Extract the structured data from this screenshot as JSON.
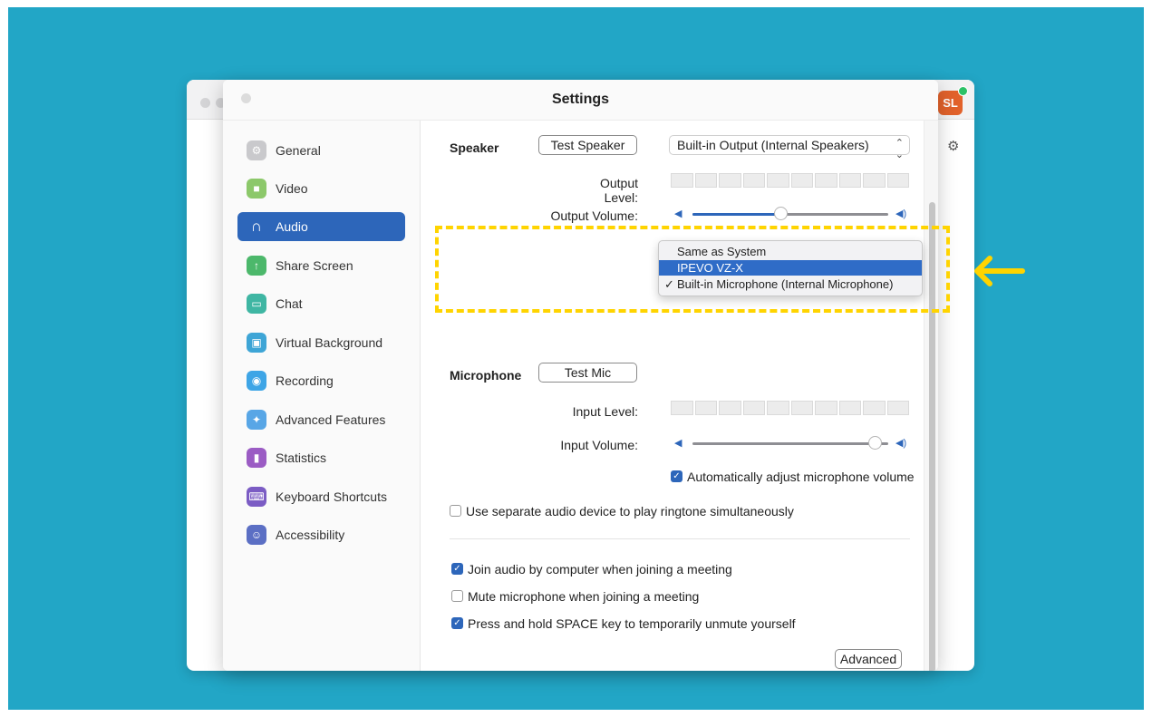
{
  "window": {
    "title": "Settings",
    "avatar_initials": "SL"
  },
  "sidebar": {
    "items": [
      {
        "label": "General",
        "icon": "gear-icon",
        "color": "#c9c9cc"
      },
      {
        "label": "Video",
        "icon": "video-icon",
        "color": "#8cc86a"
      },
      {
        "label": "Audio",
        "icon": "headphones-icon",
        "color": "#2d66ba",
        "active": true
      },
      {
        "label": "Share Screen",
        "icon": "share-screen-icon",
        "color": "#4cb86b"
      },
      {
        "label": "Chat",
        "icon": "chat-icon",
        "color": "#3fb6a3"
      },
      {
        "label": "Virtual Background",
        "icon": "virtual-background-icon",
        "color": "#3ea5d6"
      },
      {
        "label": "Recording",
        "icon": "recording-icon",
        "color": "#3ea5e6"
      },
      {
        "label": "Advanced Features",
        "icon": "advanced-features-icon",
        "color": "#58a6e6"
      },
      {
        "label": "Statistics",
        "icon": "statistics-icon",
        "color": "#9b5cc4"
      },
      {
        "label": "Keyboard Shortcuts",
        "icon": "keyboard-icon",
        "color": "#7b5cc4"
      },
      {
        "label": "Accessibility",
        "icon": "accessibility-icon",
        "color": "#5b6fc4"
      }
    ]
  },
  "speaker": {
    "label": "Speaker",
    "test_button": "Test Speaker",
    "device": "Built-in Output (Internal Speakers)",
    "output_level_label": "Output Level:",
    "output_volume_label": "Output Volume:",
    "output_volume_value": 0.45
  },
  "microphone": {
    "label": "Microphone",
    "test_button": "Test Mic",
    "dropdown_options": [
      {
        "label": "Same as System",
        "highlighted": false,
        "checked": false
      },
      {
        "label": "IPEVO VZ-X",
        "highlighted": true,
        "checked": false
      },
      {
        "label": "Built-in Microphone (Internal Microphone)",
        "highlighted": false,
        "checked": true
      }
    ],
    "check_glyph": "✓",
    "input_level_label": "Input Level:",
    "input_volume_label": "Input Volume:",
    "input_volume_value": 0.93,
    "auto_adjust_label": "Automatically adjust microphone volume",
    "auto_adjust_checked": true
  },
  "options": {
    "separate_ringtone": {
      "label": "Use separate audio device to play ringtone simultaneously",
      "checked": false
    },
    "join_by_computer": {
      "label": "Join audio by computer when joining a meeting",
      "checked": true
    },
    "mute_on_join": {
      "label": "Mute microphone when joining a meeting",
      "checked": false
    },
    "space_unmute": {
      "label": "Press and hold SPACE key to temporarily unmute yourself",
      "checked": true
    }
  },
  "advanced_button": "Advanced",
  "colors": {
    "background": "#22a6c6",
    "accent": "#2d66ba",
    "highlight_dash": "#ffd400",
    "arrow": "#ffd400"
  }
}
